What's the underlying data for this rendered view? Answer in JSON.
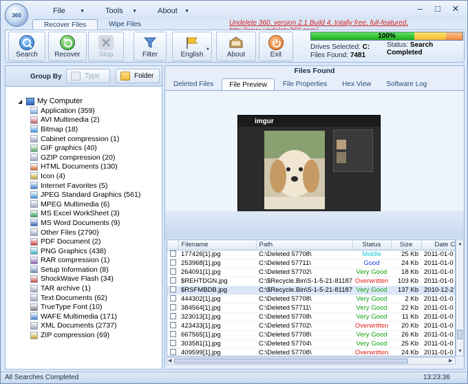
{
  "menu": {
    "file": "File",
    "tools": "Tools",
    "about": "About"
  },
  "ribbon_tabs": [
    "Recover Files",
    "Wipe Files"
  ],
  "promo": "Undelete 360, version 2.1 Build 4, totally free, full-featured, http://www.undelete360.com/",
  "toolbar": {
    "search": "Search",
    "recover": "Recover",
    "stop": "Stop",
    "filter": "Filter",
    "language": "English",
    "about": "About",
    "exit": "Exit"
  },
  "status": {
    "progress_text": "100%",
    "progress_value": 1.0,
    "drives_label": "Drives Selected:",
    "drives_value": "C:",
    "files_label": "Files Found:",
    "files_value": "7481",
    "status_label": "Status:",
    "status_value": "Search Completed"
  },
  "groupby": {
    "label": "Group By",
    "type_button": "Type",
    "folder_button": "Folder"
  },
  "tree": {
    "root": "My Computer",
    "items": [
      "Application (359)",
      "AVI Multimedia (2)",
      "Bitmap (18)",
      "Cabinet compression (1)",
      "GIF graphics (40)",
      "GZIP compression (20)",
      "HTML Documents (130)",
      "Icon (4)",
      "Internet Favorites (5)",
      "JPEG Standard Graphics (561)",
      "MPEG Multimedia (6)",
      "MS Excel WorkSheet (3)",
      "MS Word Documents (9)",
      "Other Files (2790)",
      "PDF Document (2)",
      "PNG Graphics (438)",
      "RAR compression (1)",
      "Setup Information (8)",
      "ShockWave Flash (34)",
      "TAR archive (1)",
      "Text Documents (62)",
      "TrueType Font (10)",
      "WAFE Multimedia (171)",
      "XML Documents (2737)",
      "ZIP compression (69)"
    ]
  },
  "right": {
    "heading": "Files Found",
    "tabs": [
      "Deleted Files",
      "File Preview",
      "File Properties",
      "Hex View",
      "Software Log"
    ],
    "preview_logo": "imgur"
  },
  "table": {
    "columns": [
      "Filename",
      "Path",
      "Status",
      "Size",
      "Date Cre"
    ],
    "rows": [
      {
        "name": "177426[1].jpg",
        "path": "C:\\Deleted 57708\\",
        "status": "Middle",
        "status_color": "#18c7d8",
        "size": "25 Kb",
        "date": "2011-01-0"
      },
      {
        "name": "253968[1].jpg",
        "path": "C:\\Deleted 57711\\",
        "status": "Good",
        "status_color": "#1f3fd6",
        "size": "24 Kb",
        "date": "2011-01-0"
      },
      {
        "name": "264091[1].jpg",
        "path": "C:\\Deleted 57702\\",
        "status": "Very Good",
        "status_color": "#12a312",
        "size": "18 Kb",
        "date": "2011-01-0"
      },
      {
        "name": "$REHTDGN.jpg",
        "path": "C:\\$Recycle.Bin\\S-1-5-21-8118711...",
        "status": "Overwritten",
        "status_color": "#e01b1b",
        "size": "103 Kb",
        "date": "2011-01-0"
      },
      {
        "name": "$RSFMBDB.jpg",
        "path": "C:\\$Recycle.Bin\\S-1-5-21-8118711...",
        "status": "Very Good",
        "status_color": "#12a312",
        "size": "137 Kb",
        "date": "2010-12-2"
      },
      {
        "name": "444302[1].jpg",
        "path": "C:\\Deleted 57708\\",
        "status": "Very Good",
        "status_color": "#12a312",
        "size": "2 Kb",
        "date": "2011-01-0"
      },
      {
        "name": "384564[1].jpg",
        "path": "C:\\Deleted 57711\\",
        "status": "Very Good",
        "status_color": "#12a312",
        "size": "22 Kb",
        "date": "2011-01-0"
      },
      {
        "name": "323013[1].jpg",
        "path": "C:\\Deleted 57708\\",
        "status": "Very Good",
        "status_color": "#12a312",
        "size": "11 Kb",
        "date": "2011-01-0"
      },
      {
        "name": "423433[1].jpg",
        "path": "C:\\Deleted 57702\\",
        "status": "Overwritten",
        "status_color": "#e01b1b",
        "size": "20 Kb",
        "date": "2011-01-0"
      },
      {
        "name": "667565[1].jpg",
        "path": "C:\\Deleted 57708\\",
        "status": "Very Good",
        "status_color": "#12a312",
        "size": "26 Kb",
        "date": "2011-01-0"
      },
      {
        "name": "303581[1].jpg",
        "path": "C:\\Deleted 57704\\",
        "status": "Very Good",
        "status_color": "#12a312",
        "size": "25 Kb",
        "date": "2011-01-0"
      },
      {
        "name": "409599[1].jpg",
        "path": "C:\\Deleted 57708\\",
        "status": "Overwritten",
        "status_color": "#e01b1b",
        "size": "24 Kb",
        "date": "2011-01-0"
      }
    ]
  },
  "statusbar": {
    "left": "All Searches Completed",
    "time": "13:23:36"
  },
  "colors": {
    "accent": "#3b6fb0",
    "promo": "#d21f1f",
    "progress": "#1fae1f"
  }
}
